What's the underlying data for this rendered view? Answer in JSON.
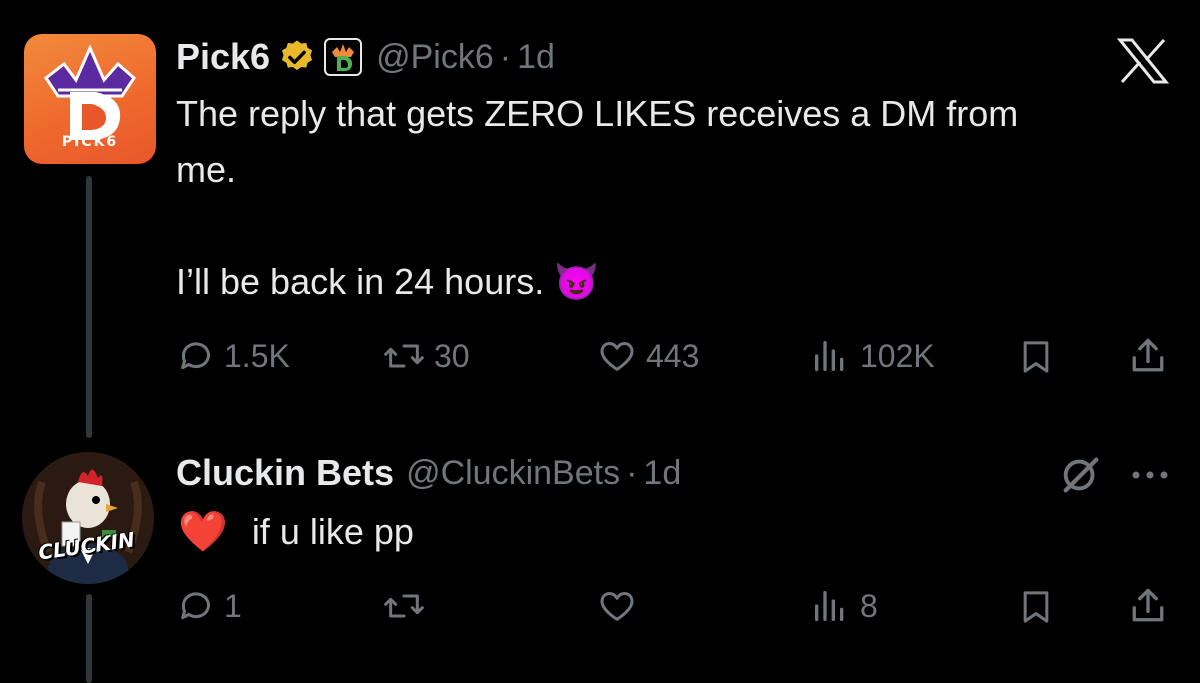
{
  "tweet": {
    "display_name": "Pick6",
    "handle": "@Pick6",
    "separator": "·",
    "time": "1d",
    "avatar_label": "PICK6",
    "body": "The reply that gets ZERO LIKES receives a DM from\nme.\n\nI’ll be back in 24 hours. 😈",
    "replies": "1.5K",
    "reposts": "30",
    "likes": "443",
    "views": "102K",
    "icons": [
      "verified-badge-icon",
      "draftkings-crown-icon",
      "x-logo-icon",
      "reply-icon",
      "repost-icon",
      "like-icon",
      "views-icon",
      "bookmark-icon",
      "share-icon"
    ]
  },
  "reply": {
    "display_name": "Cluckin Bets",
    "handle": "@CluckinBets",
    "separator": "·",
    "time": "1d",
    "avatar_label": "CLUCKIN",
    "heart": "❤️",
    "body": "if u like pp",
    "replies": "1",
    "views": "8",
    "icons": [
      "grok-icon",
      "more-icon",
      "reply-icon",
      "repost-icon",
      "like-icon",
      "views-icon",
      "bookmark-icon",
      "share-icon"
    ]
  },
  "colors": {
    "background": "#000000",
    "text": "#e7e9ea",
    "muted": "#71767b",
    "verified": "#e8b928",
    "pick6_orange": "#ef6a2e"
  }
}
